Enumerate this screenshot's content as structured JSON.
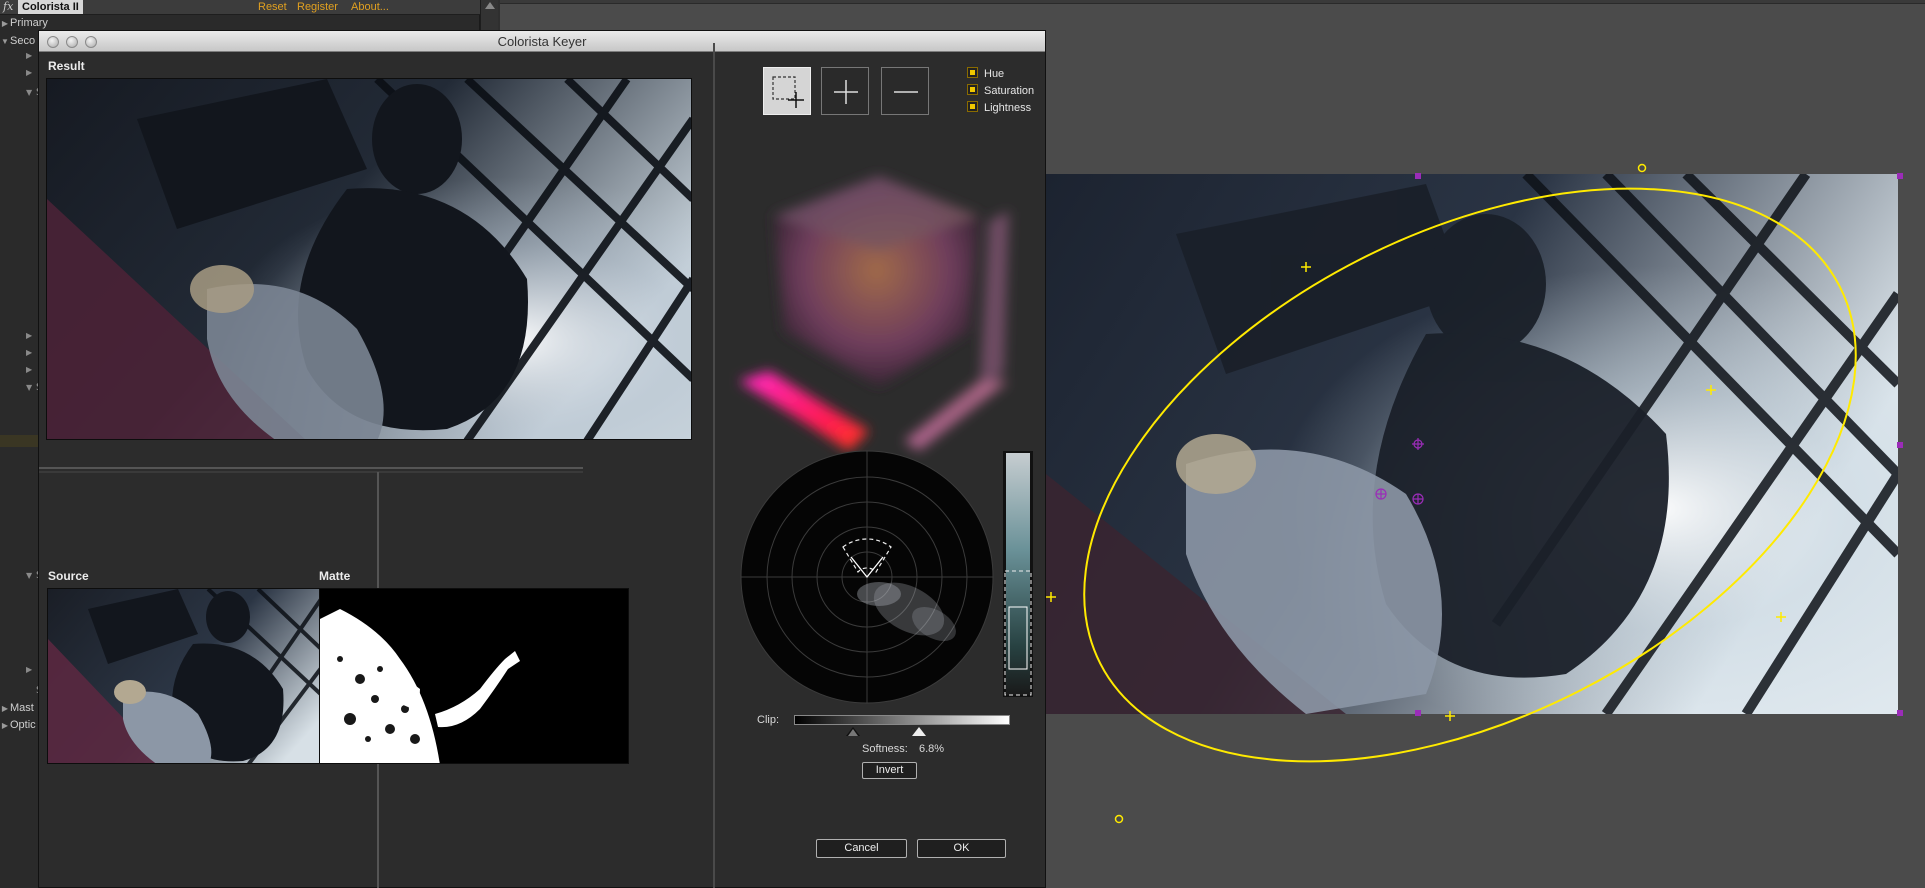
{
  "effect_panel": {
    "fx_icon": "fx",
    "effect_name": "Colorista II",
    "links": [
      "Reset",
      "Register",
      "About..."
    ],
    "rows": [
      {
        "label": "Primary",
        "expanded": false
      },
      {
        "label": "Seco",
        "expanded": true
      },
      {
        "label": "Mast",
        "expanded": false
      },
      {
        "label": "Optic",
        "expanded": false
      }
    ]
  },
  "dialog": {
    "title": "Colorista Keyer",
    "result_label": "Result",
    "source_label": "Source",
    "matte_label": "Matte",
    "checkboxes": [
      {
        "label": "Hue",
        "checked": true
      },
      {
        "label": "Saturation",
        "checked": true
      },
      {
        "label": "Lightness",
        "checked": true
      }
    ],
    "clip_label": "Clip:",
    "softness_label": "Softness:",
    "softness_value": "6.8%",
    "invert_label": "Invert",
    "cancel_label": "Cancel",
    "ok_label": "OK",
    "icons": {
      "select_add": "select-add-icon",
      "add": "plus-icon",
      "subtract": "minus-icon"
    }
  },
  "colors": {
    "accent_link": "#e0a020",
    "mask_yellow": "#ffea00",
    "handle_purple": "#9b2cb8",
    "checkbox_yellow": "#f0c800"
  }
}
